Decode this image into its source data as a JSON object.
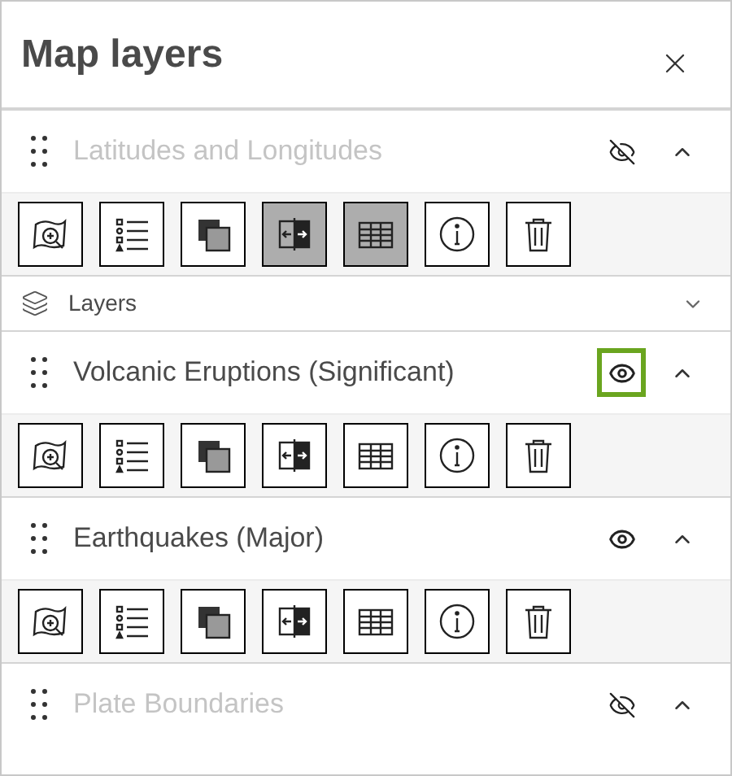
{
  "panel": {
    "title": "Map layers"
  },
  "layers": [
    {
      "name": "Latitudes and Longitudes",
      "visible": false,
      "highlighted": false,
      "expanded": true,
      "tools": [
        {
          "kind": "zoom",
          "selected": false
        },
        {
          "kind": "legend",
          "selected": false
        },
        {
          "kind": "transparency",
          "selected": false
        },
        {
          "kind": "swipe",
          "selected": true
        },
        {
          "kind": "table",
          "selected": true
        },
        {
          "kind": "info",
          "selected": false
        },
        {
          "kind": "remove",
          "selected": false
        }
      ],
      "sublayers": {
        "label": "Layers",
        "expanded": false
      }
    },
    {
      "name": "Volcanic Eruptions (Significant)",
      "visible": true,
      "highlighted": true,
      "expanded": true,
      "tools": [
        {
          "kind": "zoom",
          "selected": false
        },
        {
          "kind": "legend",
          "selected": false
        },
        {
          "kind": "transparency",
          "selected": false
        },
        {
          "kind": "swipe",
          "selected": false
        },
        {
          "kind": "table",
          "selected": false
        },
        {
          "kind": "info",
          "selected": false
        },
        {
          "kind": "remove",
          "selected": false
        }
      ]
    },
    {
      "name": "Earthquakes (Major)",
      "visible": true,
      "highlighted": false,
      "expanded": true,
      "tools": [
        {
          "kind": "zoom",
          "selected": false
        },
        {
          "kind": "legend",
          "selected": false
        },
        {
          "kind": "transparency",
          "selected": false
        },
        {
          "kind": "swipe",
          "selected": false
        },
        {
          "kind": "table",
          "selected": false
        },
        {
          "kind": "info",
          "selected": false
        },
        {
          "kind": "remove",
          "selected": false
        }
      ]
    },
    {
      "name": "Plate Boundaries",
      "visible": false,
      "highlighted": false,
      "expanded": true
    }
  ]
}
